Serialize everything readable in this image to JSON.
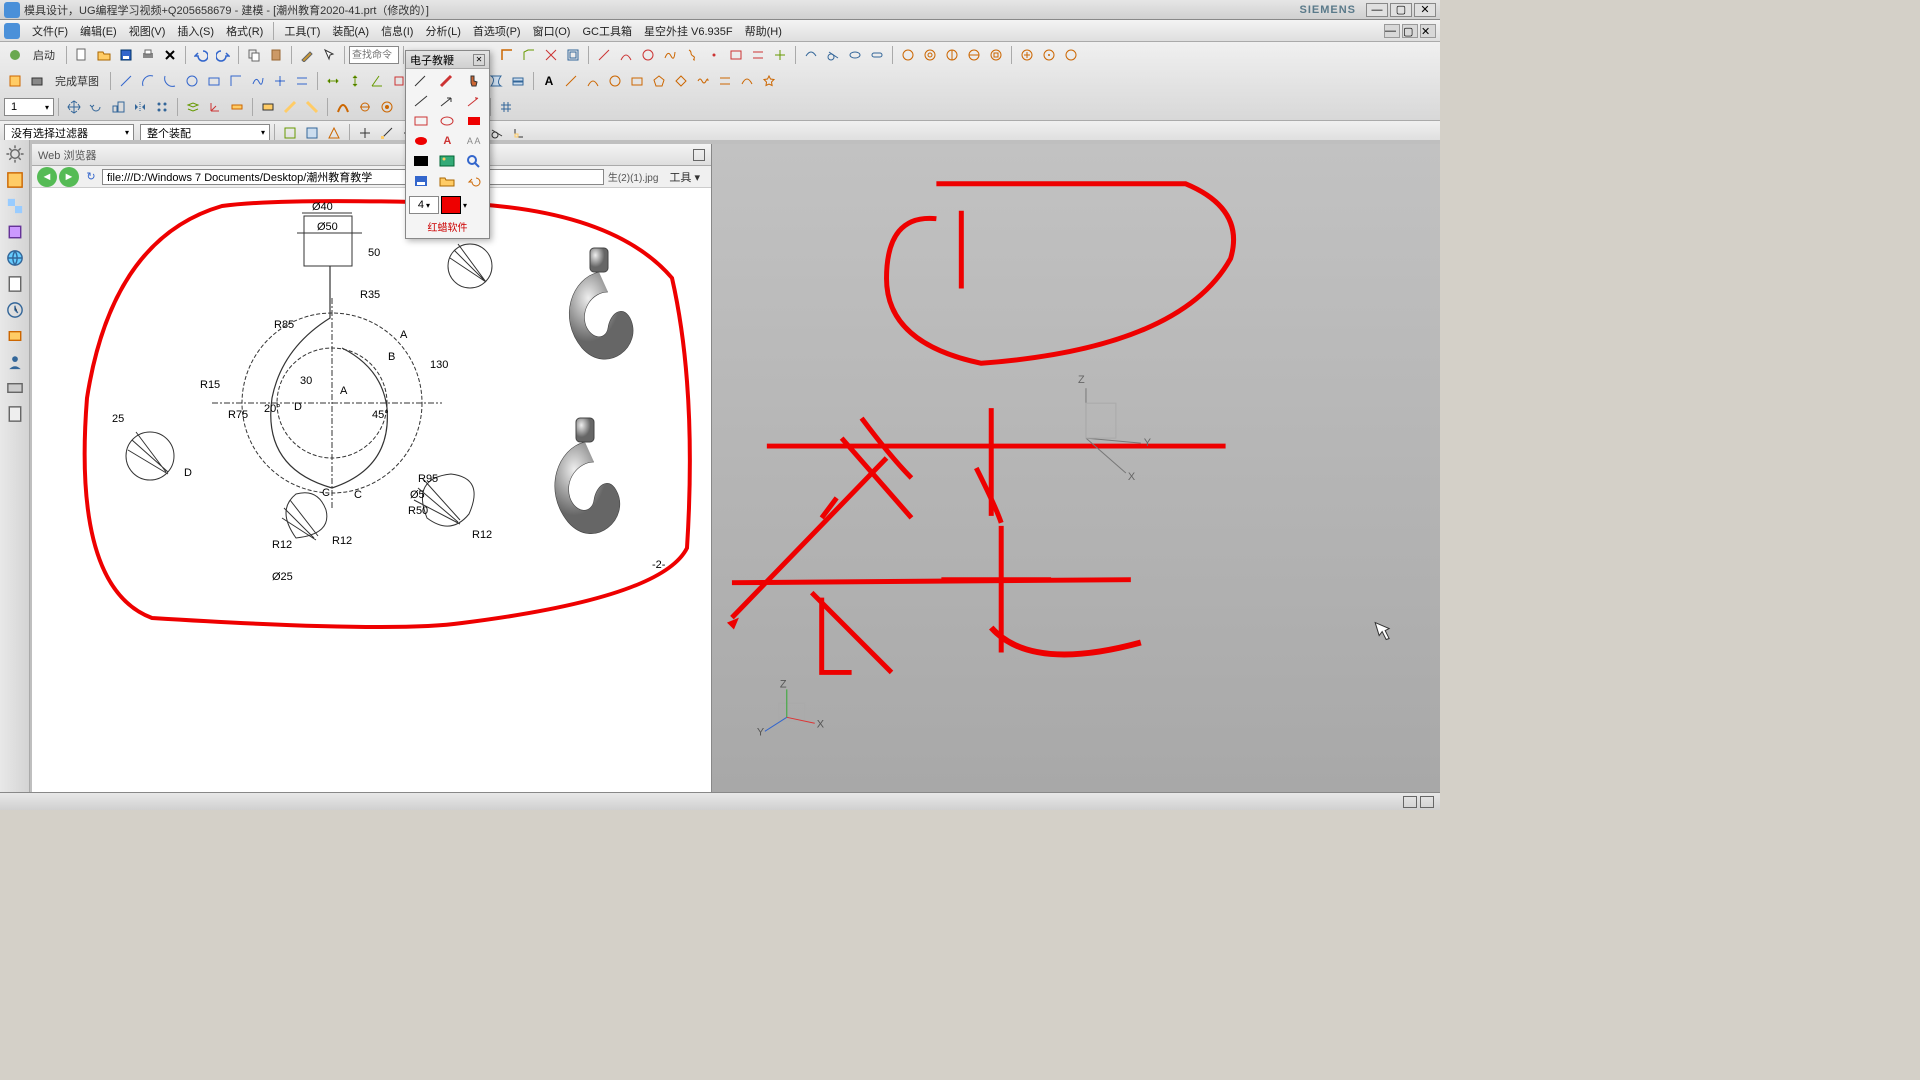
{
  "title_bar": {
    "title": "模具设计，UG编程学习视频+Q205658679 - 建模 - [潮州教育2020-41.prt（修改的）]",
    "brand": "SIEMENS",
    "min": "—",
    "max": "▢",
    "close": "✕"
  },
  "menu": {
    "items": [
      "文件(F)",
      "编辑(E)",
      "视图(V)",
      "插入(S)",
      "格式(R)",
      "工具(T)",
      "装配(A)",
      "信息(I)",
      "分析(L)",
      "首选项(P)",
      "窗口(O)",
      "GC工具箱",
      "星空外挂 V6.935F",
      "帮助(H)"
    ]
  },
  "toolbar": {
    "start_label": "启动",
    "sketch_label": "完成草图",
    "search_placeholder": "查找命令"
  },
  "filter": {
    "num_value": "1",
    "filter_label": "没有选择过滤器",
    "assembly_label": "整个装配"
  },
  "web_panel": {
    "title": "Web 浏览器",
    "url": "file:///D:/Windows 7 Documents/Desktop/潮州教育教学",
    "file_tail": "生(2)(1).jpg",
    "tools_label": "工具",
    "page_num": "-2-"
  },
  "ann_palette": {
    "title": "电子教鞭",
    "size_value": "4",
    "footer": "红蜡软件"
  },
  "icons": {
    "back": "◄",
    "forward": "►",
    "refresh": "↻"
  },
  "axes": {
    "x": "X",
    "y": "Y",
    "z": "Z"
  },
  "tech": {
    "d40": "Ø40",
    "d50": "Ø50",
    "r35": "R35",
    "r85": "R85",
    "r15": "R15",
    "r75": "R75",
    "n25": "25",
    "n30": "30",
    "n20": "20°",
    "n50": "50",
    "n130": "130",
    "n45": "45°",
    "r12": "R12",
    "r95": "R95",
    "d5": "Ø5",
    "r50": "R50",
    "d25": "Ø25",
    "labA": "A",
    "labB": "B",
    "labC": "C",
    "labD": "D"
  }
}
